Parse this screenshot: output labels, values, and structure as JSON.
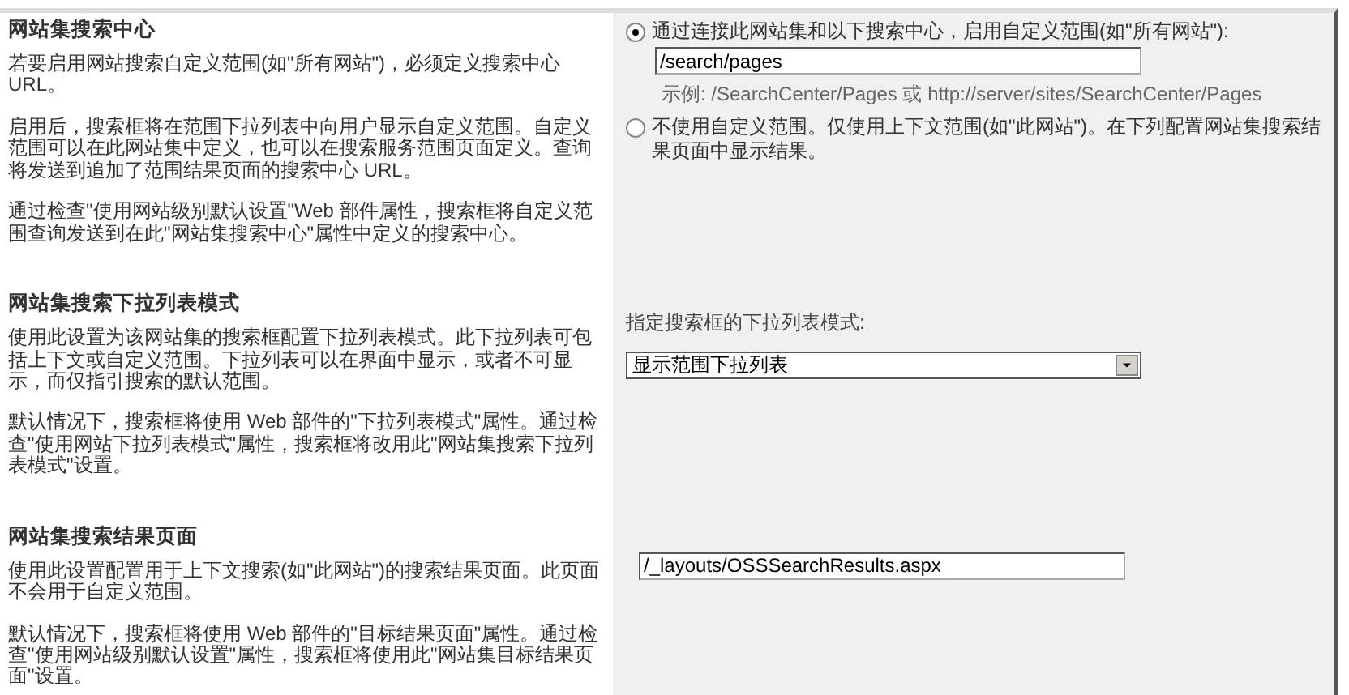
{
  "sections": [
    {
      "title": "网站集搜索中心",
      "paragraphs": [
        "若要启用网站搜索自定义范围(如\"所有网站\")，必须定义搜索中心 URL。",
        "启用后，搜索框将在范围下拉列表中向用户显示自定义范围。自定义范围可以在此网站集中定义，也可以在搜索服务范围页面定义。查询将发送到追加了范围结果页面的搜索中心 URL。",
        "通过检查\"使用网站级别默认设置\"Web 部件属性，搜索框将自定义范围查询发送到在此\"网站集搜索中心\"属性中定义的搜索中心。"
      ],
      "control": {
        "kind": "radios",
        "options": [
          {
            "label": "通过连接此网站集和以下搜索中心，启用自定义范围(如\"所有网站\"):",
            "selected": true,
            "field_value": "/search/pages",
            "example": "示例: /SearchCenter/Pages 或 http://server/sites/SearchCenter/Pages"
          },
          {
            "label": "不使用自定义范围。仅使用上下文范围(如\"此网站\")。在下列配置网站集搜索结果页面中显示结果。",
            "selected": false
          }
        ]
      }
    },
    {
      "title": "网站集搜索下拉列表模式",
      "paragraphs": [
        "使用此设置为该网站集的搜索框配置下拉列表模式。此下拉列表可包括上下文或自定义范围。下拉列表可以在界面中显示，或者不可显示，而仅指引搜索的默认范围。",
        "默认情况下，搜索框将使用 Web 部件的\"下拉列表模式\"属性。通过检查\"使用网站下拉列表模式\"属性，搜索框将改用此\"网站集搜索下拉列表模式\"设置。"
      ],
      "control": {
        "kind": "select",
        "label": "指定搜索框的下拉列表模式:",
        "value": "显示范围下拉列表"
      }
    },
    {
      "title": "网站集搜索结果页面",
      "paragraphs": [
        "使用此设置配置用于上下文搜索(如\"此网站\")的搜索结果页面。此页面不会用于自定义范围。",
        "默认情况下，搜索框将使用 Web 部件的\"目标结果页面\"属性。通过检查\"使用网站级别默认设置\"属性，搜索框将使用此\"网站集目标结果页面\"设置。"
      ],
      "control": {
        "kind": "text",
        "value": "/_layouts/OSSSearchResults.aspx"
      }
    }
  ]
}
